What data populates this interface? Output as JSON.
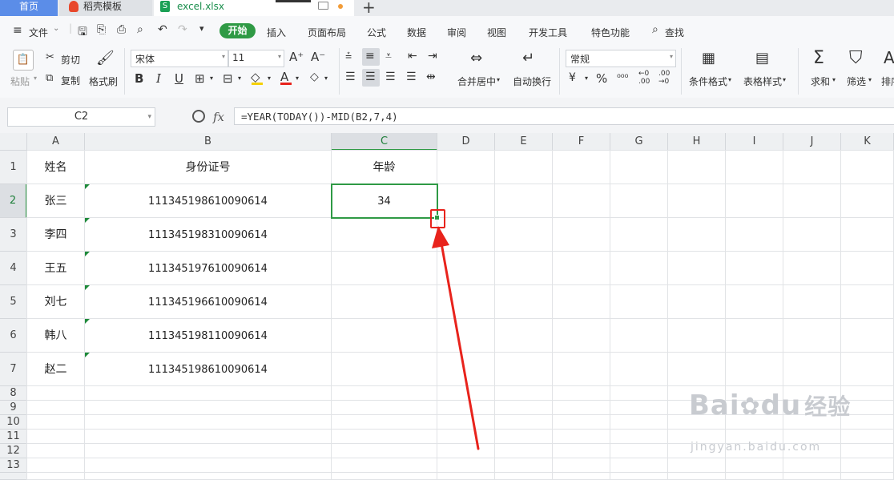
{
  "tabs": {
    "home": "首页",
    "template": "稻壳模板",
    "file": "excel.xlsx",
    "file_icon": "S"
  },
  "menu": {
    "file": "文件",
    "items": [
      "开始",
      "插入",
      "页面布局",
      "公式",
      "数据",
      "审阅",
      "视图",
      "开发工具",
      "特色功能"
    ],
    "search": "查找"
  },
  "ribbon": {
    "paste": "粘贴",
    "cut": "剪切",
    "copy": "复制",
    "format_painter": "格式刷",
    "font_name": "宋体",
    "font_size": "11",
    "merge_center": "合并居中",
    "wrap_text": "自动换行",
    "number_format": "常规",
    "conditional_format": "条件格式",
    "table_style": "表格样式",
    "sum": "求和",
    "filter": "筛选",
    "sort": "排序"
  },
  "formula_bar": {
    "cell_ref": "C2",
    "fx": "fx",
    "formula": "=YEAR(TODAY())-MID(B2,7,4)"
  },
  "sheet": {
    "columns": [
      "A",
      "B",
      "C",
      "D",
      "E",
      "F",
      "G",
      "H",
      "I",
      "J",
      "K"
    ],
    "selected_column": "C",
    "selected_row": "2",
    "header_row": [
      "姓名",
      "身份证号",
      "年龄"
    ],
    "rows": [
      {
        "num": "2",
        "name": "张三",
        "id": "111345198610090614",
        "age": "34"
      },
      {
        "num": "3",
        "name": "李四",
        "id": "111345198310090614",
        "age": ""
      },
      {
        "num": "4",
        "name": "王五",
        "id": "111345197610090614",
        "age": ""
      },
      {
        "num": "5",
        "name": "刘七",
        "id": "111345196610090614",
        "age": ""
      },
      {
        "num": "6",
        "name": "韩八",
        "id": "111345198110090614",
        "age": ""
      },
      {
        "num": "7",
        "name": "赵二",
        "id": "111345198610090614",
        "age": ""
      }
    ],
    "empty_rows": [
      "8",
      "9",
      "10",
      "11",
      "12",
      "13"
    ]
  },
  "watermark": {
    "brand": "Bai",
    "brand_tail": "du",
    "product": "经验",
    "url": "jingyan.baidu.com"
  },
  "colors": {
    "accent": "#2f9a45",
    "annotation": "#e8231c",
    "home_tab": "#5b8de8"
  }
}
